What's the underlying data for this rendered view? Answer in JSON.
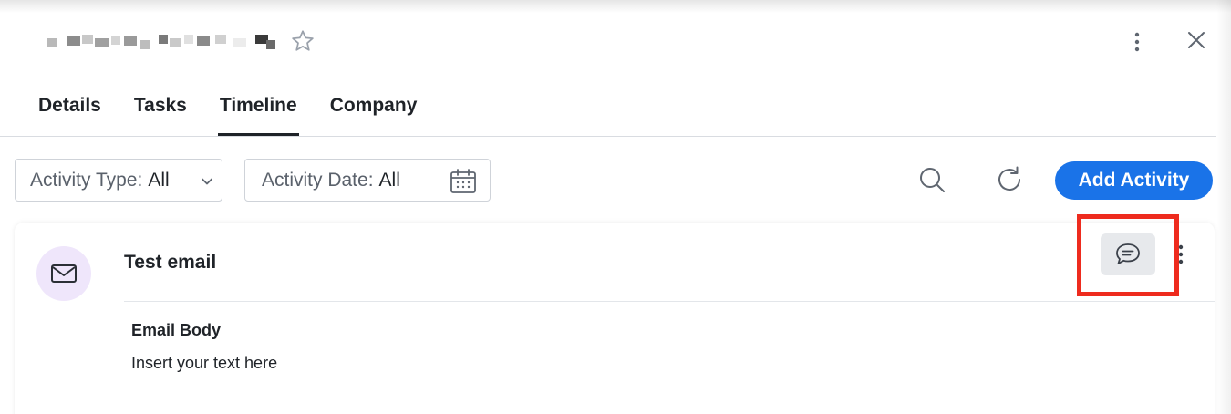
{
  "header": {
    "record_name_redacted": true,
    "icons": [
      "star-icon",
      "more-vertical-icon",
      "close-icon"
    ]
  },
  "tabs": [
    {
      "label": "Details",
      "active": false
    },
    {
      "label": "Tasks",
      "active": false
    },
    {
      "label": "Timeline",
      "active": true
    },
    {
      "label": "Company",
      "active": false
    }
  ],
  "filters": {
    "activity_type": {
      "label": "Activity Type:",
      "value": "All"
    },
    "activity_date": {
      "label": "Activity Date:",
      "value": "All"
    }
  },
  "toolbar": {
    "add_activity_label": "Add Activity"
  },
  "activity": {
    "icon": "mail-icon",
    "title": "Test email",
    "field_label": "Email Body",
    "field_value": "Insert your text here",
    "comment_icon": "comment-icon"
  },
  "colors": {
    "accent": "#1a73e8",
    "highlight": "#ee2b1e",
    "avatar_bg": "#efe6fb",
    "comment_bg": "#e7e9ec"
  }
}
